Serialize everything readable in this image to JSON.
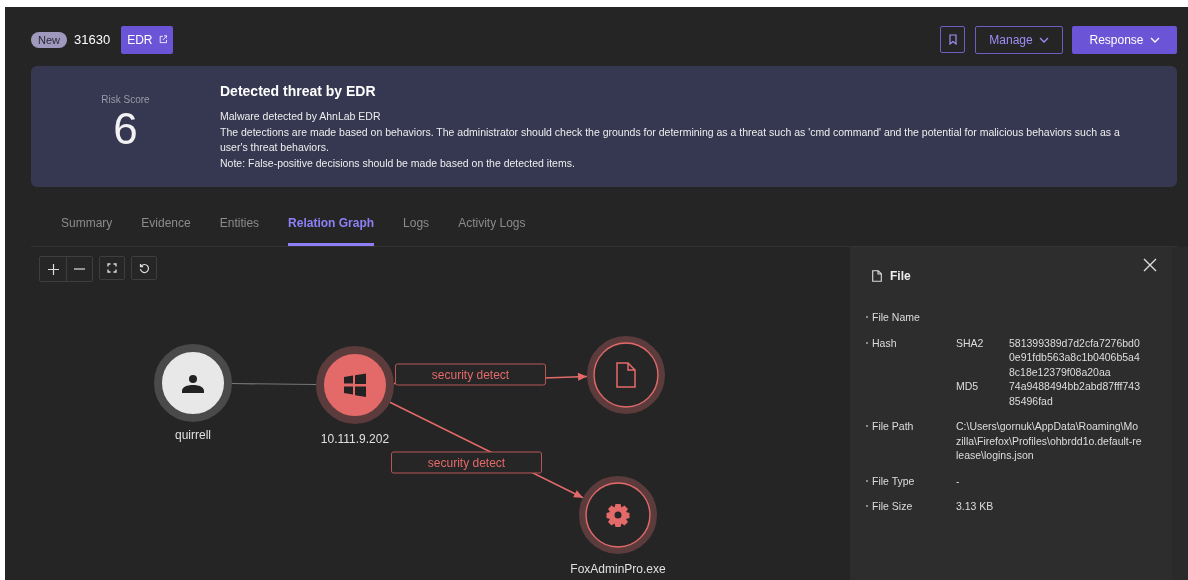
{
  "header": {
    "status_badge": "New",
    "incident_id": "31630",
    "edr_button": "EDR",
    "manage_button": "Manage",
    "response_button": "Response"
  },
  "summary": {
    "risk_label": "Risk Score",
    "risk_score": "6",
    "title": "Detected threat by EDR",
    "lines": [
      "Malware detected by AhnLab EDR",
      "The detections are made based on behaviors. The administrator should check the grounds for determining as a threat such as 'cmd command' and the potential for malicious behaviors such as a user's threat behaviors.",
      "Note: False-positive decisions should be made based on the detected items."
    ]
  },
  "tabs": [
    {
      "label": "Summary",
      "selected": false
    },
    {
      "label": "Evidence",
      "selected": false
    },
    {
      "label": "Entities",
      "selected": false
    },
    {
      "label": "Relation Graph",
      "selected": true
    },
    {
      "label": "Logs",
      "selected": false
    },
    {
      "label": "Activity Logs",
      "selected": false
    }
  ],
  "graph": {
    "nodes": [
      {
        "kind": "user",
        "label": "quirrell"
      },
      {
        "kind": "host",
        "label": "10.111.9.202"
      },
      {
        "kind": "file"
      },
      {
        "kind": "process",
        "label": "FoxAdminPro.exe"
      }
    ],
    "edges": [
      {
        "kind": "plain"
      },
      {
        "kind": "detect",
        "label": "security detect"
      },
      {
        "kind": "detect",
        "label": "security detect"
      }
    ]
  },
  "panel": {
    "title": "File",
    "fields": [
      {
        "label": "File Name"
      },
      {
        "label": "Hash",
        "hashes": [
          {
            "type": "SHA2",
            "value": "581399389d7d2cfa7276bd00e91fdb563a8c1b0406b5a48c18e12379f08a20aa"
          },
          {
            "type": "MD5",
            "value": "74a9488494bb2abd87fff74385496fad"
          }
        ]
      },
      {
        "label": "File Path",
        "value": "C:\\Users\\gornuk\\AppData\\Roaming\\Mozilla\\Firefox\\Profiles\\ohbrdd1o.default-release\\logins.json"
      },
      {
        "label": "File Type",
        "value": "-"
      },
      {
        "label": "File Size",
        "value": "3.13 KB"
      }
    ]
  }
}
